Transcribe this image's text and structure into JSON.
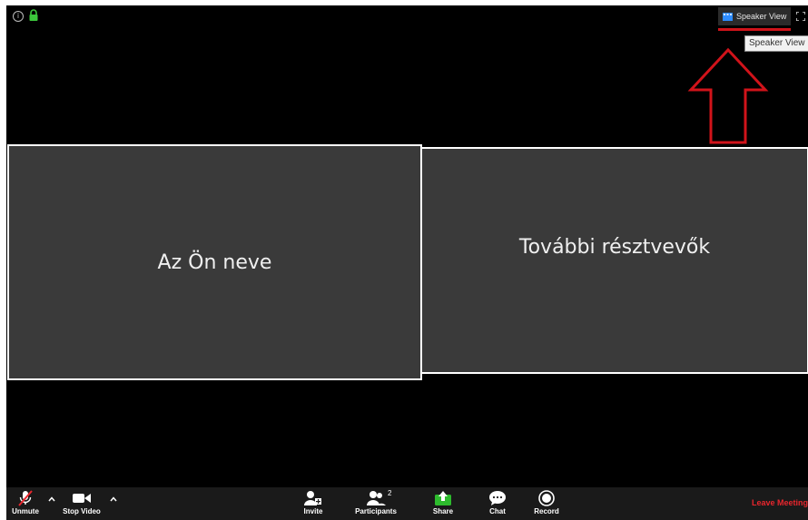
{
  "top_bar": {
    "speaker_view_label": "Speaker View",
    "tooltip": "Speaker View"
  },
  "tiles": {
    "self_name": "Az Ön neve",
    "others_name": "További résztvevők"
  },
  "toolbar": {
    "unmute_label": "Unmute",
    "stop_video_label": "Stop Video",
    "invite_label": "Invite",
    "participants_label": "Participants",
    "participants_count": "2",
    "share_label": "Share",
    "chat_label": "Chat",
    "record_label": "Record",
    "leave_label": "Leave Meeting"
  },
  "colors": {
    "background": "#000000",
    "tile": "#3a3a3a",
    "toolbar": "#1a1a1a",
    "share_green": "#2dbb2d",
    "leave_red": "#e8262d",
    "annotation_red": "#d1131a",
    "lock_green": "#3cc83c"
  },
  "icons": {
    "info": "info-icon",
    "lock": "lock-icon",
    "speaker_view": "speaker-view-icon",
    "fullscreen": "fullscreen-icon",
    "mic_muted": "mic-muted-icon",
    "video": "video-camera-icon",
    "invite": "invite-icon",
    "participants": "participants-icon",
    "share": "share-screen-icon",
    "chat": "chat-icon",
    "record": "record-icon"
  }
}
